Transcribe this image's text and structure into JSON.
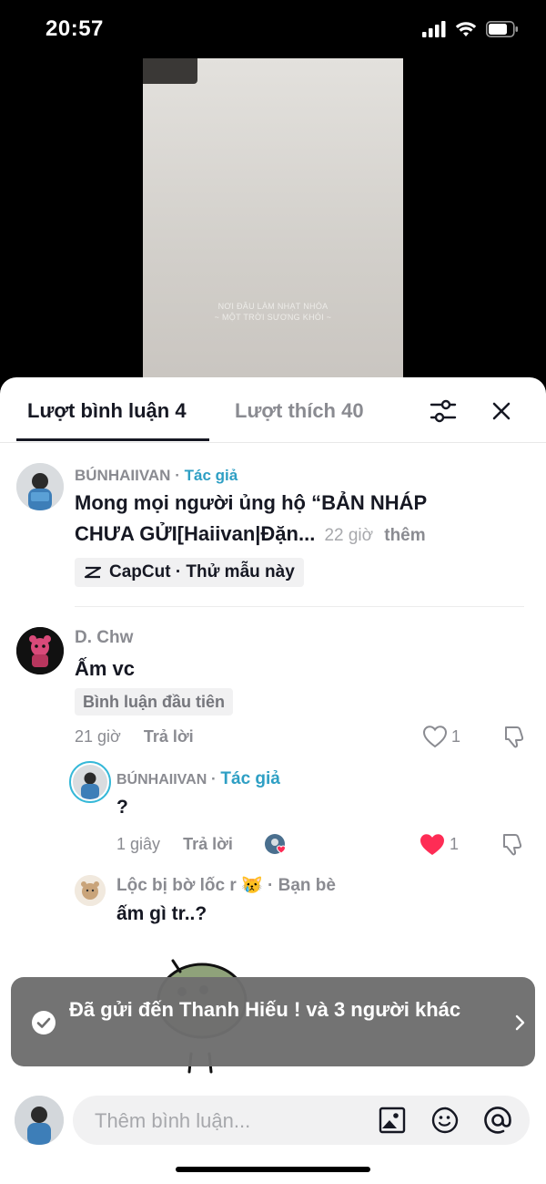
{
  "status_bar": {
    "time": "20:57"
  },
  "video": {
    "caption_line1": "NƠI ĐÂU LÀM NHẠT NHÒA",
    "caption_line2": "~ MỘT TRỜI SƯƠNG KHÓI ~"
  },
  "tabs": {
    "comments": "Lượt bình luận 4",
    "likes": "Lượt thích 40"
  },
  "comments": [
    {
      "username": "BÚNHAIIVAN",
      "separator": "·",
      "author_tag": "Tác giả",
      "text_line1": "Mong mọi người ủng hộ “BẢN NHÁP",
      "text_line2": "CHƯA GỬI[Haiivan|Đặn...",
      "time": "22 giờ",
      "more": "thêm",
      "chip": "CapCut · Thử mẫu này"
    },
    {
      "username": "D. Chw",
      "text": "Ấm vc",
      "badge": "Bình luận đầu tiên",
      "time": "21 giờ",
      "reply": "Trả lời",
      "likes": "1"
    }
  ],
  "replies": [
    {
      "username": "BÚNHAIIVAN",
      "separator": "·",
      "author_tag": "Tác giả",
      "text": "?",
      "time": "1 giây",
      "reply": "Trả lời",
      "likes": "1"
    },
    {
      "username": "Lộc bị bờ lốc r",
      "emoji": "😿",
      "separator": "·",
      "friend_tag": "Bạn bè",
      "text": "ấm gì tr..?"
    }
  ],
  "toast": {
    "text": "Đã gửi đến Thanh Hiếu ! và 3 người khác"
  },
  "input": {
    "placeholder": "Thêm bình luận..."
  },
  "colors": {
    "author": "#2e9fc4",
    "like_red": "#fe2c55",
    "toast_bg": "#6e6e6e"
  }
}
